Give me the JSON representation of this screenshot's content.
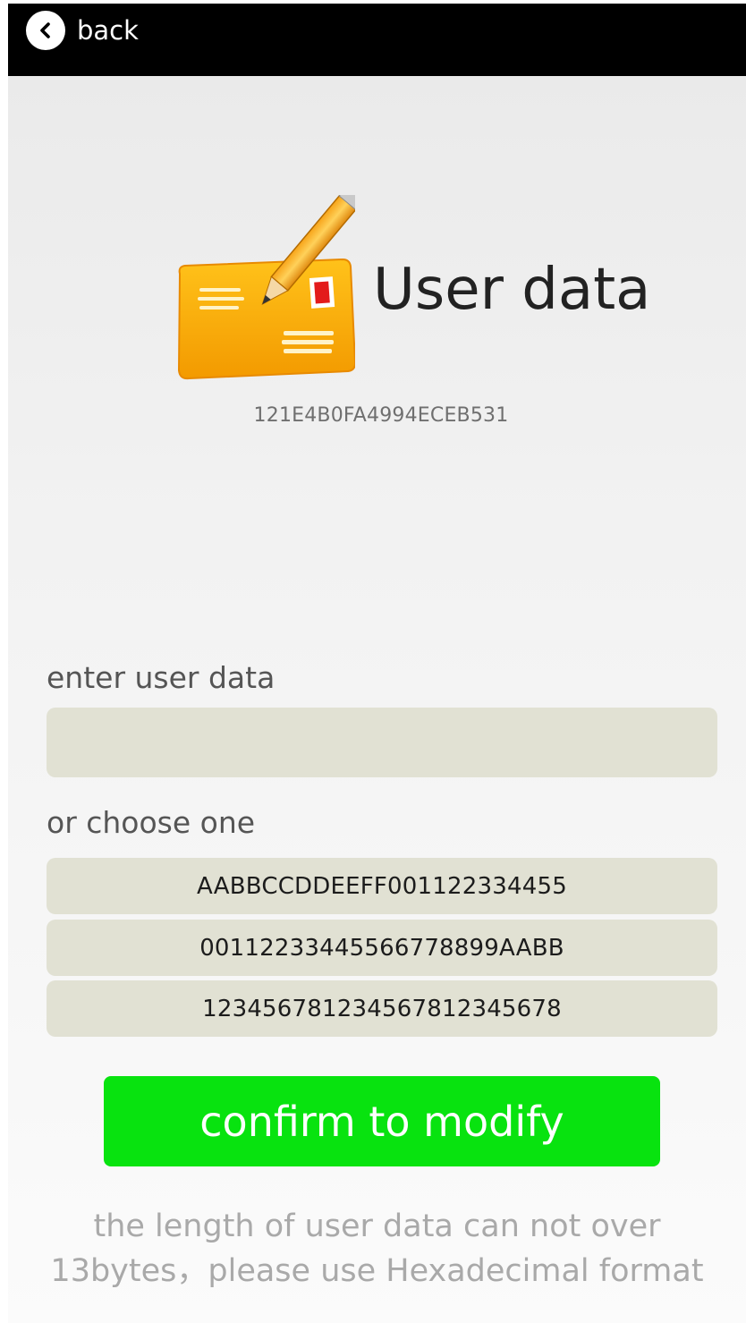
{
  "topbar": {
    "back_label": "back",
    "back_icon": "chevron-left-icon"
  },
  "header": {
    "logo_icon": "envelope-pencil-icon",
    "title": "User data",
    "device_id": "121E4B0FA4994ECEB531"
  },
  "form": {
    "enter_label": "enter user data",
    "input_value": "",
    "input_placeholder": "",
    "choose_label": "or choose one",
    "options": [
      "AABBCCDDEEFF001122334455",
      "00112233445566778899AABB",
      "123456781234567812345678"
    ],
    "confirm_label": "confirm to modify"
  },
  "hint": {
    "line1": "the length of user data can not over",
    "line2": "13bytes，please use Hexadecimal format"
  },
  "colors": {
    "topbar": "#000000",
    "field_bg": "#e1e1d3",
    "confirm_bg": "#08e30f",
    "hint_text": "#a9a9a9"
  }
}
